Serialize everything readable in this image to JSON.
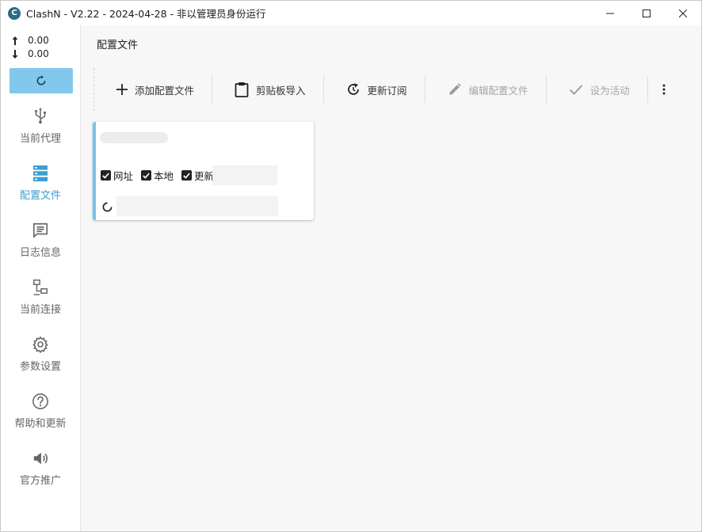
{
  "window": {
    "title": "ClashN - V2.22 - 2024-04-28 - 非以管理员身份运行",
    "logo_letter": "C"
  },
  "speed": {
    "up": "0.00",
    "down": "0.00"
  },
  "nav": [
    {
      "label": "当前代理",
      "icon": "proxy-usb-icon",
      "active": false
    },
    {
      "label": "配置文件",
      "icon": "server-stack-icon",
      "active": true
    },
    {
      "label": "日志信息",
      "icon": "message-text-icon",
      "active": false
    },
    {
      "label": "当前连接",
      "icon": "network-lan-icon",
      "active": false
    },
    {
      "label": "参数设置",
      "icon": "gear-icon",
      "active": false
    },
    {
      "label": "帮助和更新",
      "icon": "help-circle-icon",
      "active": false
    },
    {
      "label": "官方推广",
      "icon": "speaker-icon",
      "active": false
    }
  ],
  "main": {
    "title": "配置文件",
    "toolbar": {
      "add": "添加配置文件",
      "clipboard": "剪贴板导入",
      "update": "更新订阅",
      "edit": "编辑配置文件",
      "activate": "设为活动"
    },
    "card": {
      "url_label": "网址",
      "local_label": "本地",
      "update_label": "更新"
    }
  },
  "colors": {
    "accent": "#81c8ec",
    "active_nav": "#3b9fd0",
    "card_accent": "#78c3e6"
  }
}
